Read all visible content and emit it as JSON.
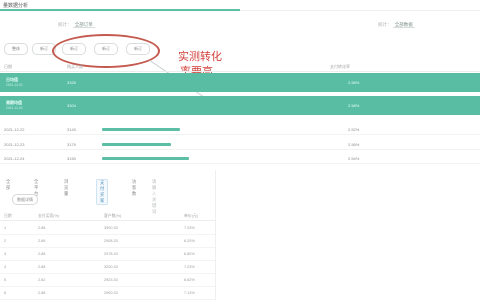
{
  "window": {
    "title": "量数据分析"
  },
  "selectors": [
    {
      "key": "统计：",
      "value": "全部订单"
    },
    {
      "key": "统计：",
      "value": "全部数据"
    }
  ],
  "sub_tabs": [
    "整体",
    "新订",
    "新订",
    "新订",
    "新订"
  ],
  "annotation": {
    "line1": "实测转化",
    "line2": "率要高"
  },
  "table": {
    "headers": [
      "日期",
      "购买人数",
      "支付转化率"
    ],
    "highlight_rows": [
      {
        "name": "日均值",
        "sub": "2021-12-01",
        "num": "3325",
        "rate": "2.58%"
      },
      {
        "name": "周期均值",
        "sub": "2021-12-01",
        "num": "3304",
        "rate": "2.58%"
      }
    ],
    "rows": [
      {
        "date": "2021-12-22",
        "num": "3143",
        "bar": 0.26,
        "rate": "2.52%"
      },
      {
        "date": "2021-12-23",
        "num": "3179",
        "bar": 0.23,
        "rate": "2.56%"
      },
      {
        "date": "2021-12-24",
        "num": "3150",
        "bar": 0.29,
        "rate": "2.54%"
      }
    ]
  },
  "panel": {
    "tabs": [
      "全部",
      "全平台",
      "浏览量",
      "支付买家",
      "访客数"
    ],
    "selected_tab": "支付买家",
    "search_placeholder": "请输入关键词",
    "pill": "数据详情",
    "headers": [
      "日期",
      "支付买家(%)",
      "客户数(%)",
      "单价(元)"
    ],
    "rows": [
      [
        "1",
        "2.88",
        "3900.33",
        "7.23%"
      ],
      [
        "2",
        "2.66",
        "2908.33",
        "6.20%"
      ],
      [
        "3",
        "2.88",
        "2978.33",
        "6.80%"
      ],
      [
        "4",
        "2.88",
        "3200.33",
        "7.23%"
      ],
      [
        "5",
        "2.62",
        "2923.33",
        "6.62%"
      ],
      [
        "6",
        "2.88",
        "2900.33",
        "7.13%"
      ]
    ]
  }
}
